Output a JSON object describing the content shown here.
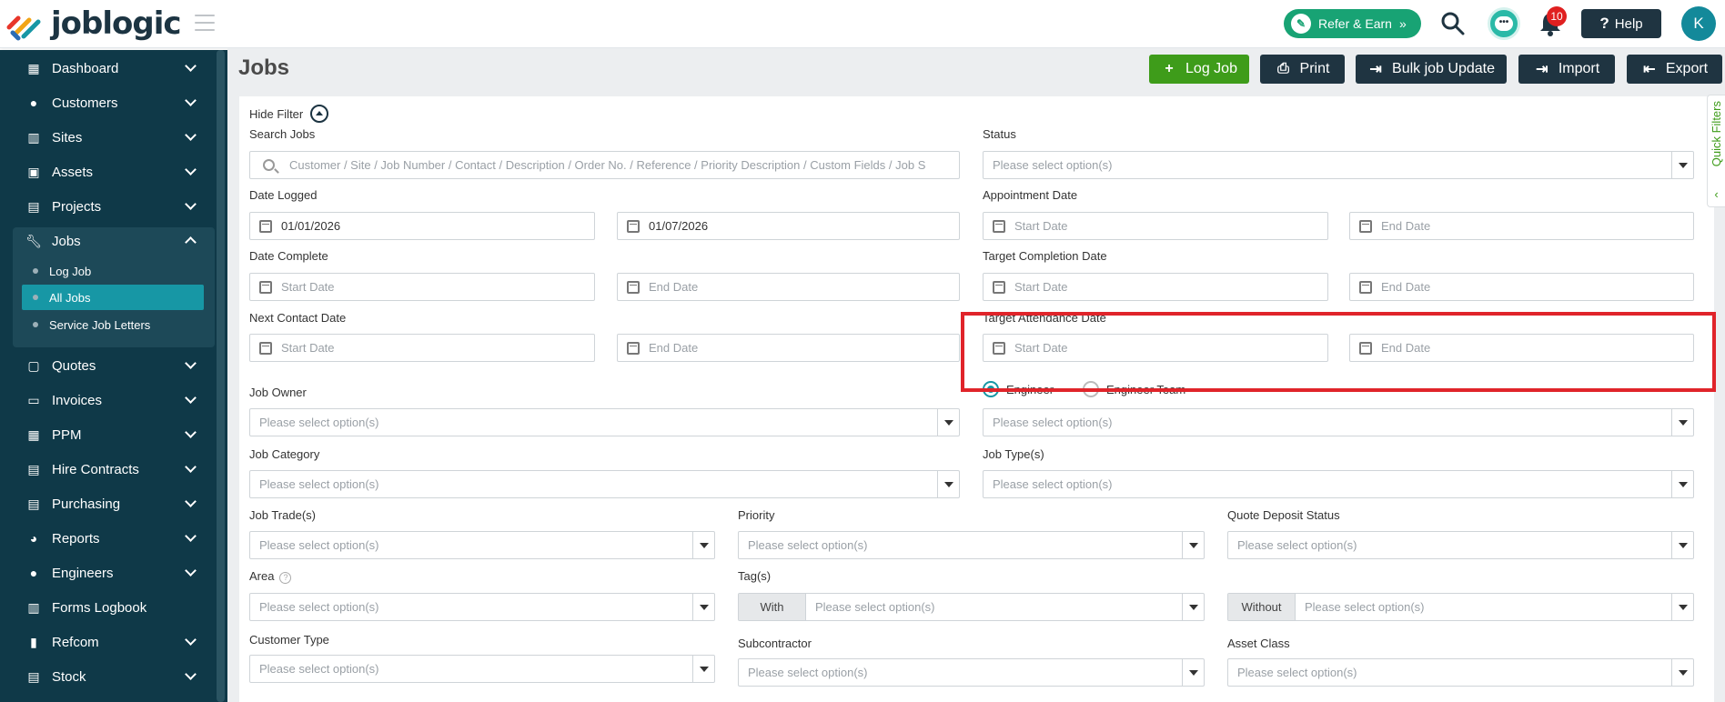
{
  "app": {
    "logo_text": "joblogic",
    "refer_label": "Refer & Earn",
    "notifications_count": "10",
    "help_label": "Help",
    "avatar_initial": "K"
  },
  "sidebar": {
    "items": [
      {
        "label": "Dashboard",
        "icon": "dashboard-icon"
      },
      {
        "label": "Customers",
        "icon": "person-icon"
      },
      {
        "label": "Sites",
        "icon": "building-icon"
      },
      {
        "label": "Assets",
        "icon": "asset-icon"
      },
      {
        "label": "Projects",
        "icon": "projects-icon"
      },
      {
        "label": "Jobs",
        "icon": "wrench-icon"
      },
      {
        "label": "Quotes",
        "icon": "quotes-icon"
      },
      {
        "label": "Invoices",
        "icon": "invoice-icon"
      },
      {
        "label": "PPM",
        "icon": "calendar-icon"
      },
      {
        "label": "Hire Contracts",
        "icon": "document-icon"
      },
      {
        "label": "Purchasing",
        "icon": "purchasing-icon"
      },
      {
        "label": "Reports",
        "icon": "pie-chart-icon"
      },
      {
        "label": "Engineers",
        "icon": "people-icon"
      },
      {
        "label": "Forms Logbook",
        "icon": "book-icon"
      },
      {
        "label": "Refcom",
        "icon": "refcom-icon"
      },
      {
        "label": "Stock",
        "icon": "stock-icon"
      }
    ],
    "jobs_sub": [
      "Log Job",
      "All Jobs",
      "Service Job Letters"
    ]
  },
  "page": {
    "title": "Jobs",
    "actions": [
      "Log Job",
      "Print",
      "Bulk job Update",
      "Import",
      "Export"
    ],
    "hide_filter": "Hide Filter",
    "quick_filters": "Quick Filters"
  },
  "filters": {
    "search_jobs": {
      "label": "Search Jobs",
      "placeholder": "Customer / Site / Job Number / Contact / Description / Order No. / Reference / Priority Description / Custom Fields / Job S"
    },
    "status": {
      "label": "Status",
      "placeholder": "Please select option(s)"
    },
    "date_logged": {
      "label": "Date Logged",
      "start": "01/01/2026",
      "end": "01/07/2026"
    },
    "appointment_date": {
      "label": "Appointment Date",
      "start": "Start Date",
      "end": "End Date"
    },
    "date_complete": {
      "label": "Date Complete",
      "start": "Start Date",
      "end": "End Date"
    },
    "target_completion": {
      "label": "Target Completion Date",
      "start": "Start Date",
      "end": "End Date"
    },
    "next_contact": {
      "label": "Next Contact Date",
      "start": "Start Date",
      "end": "End Date"
    },
    "target_attendance": {
      "label": "Target Attendance Date",
      "start": "Start Date",
      "end": "End Date"
    },
    "job_owner": {
      "label": "Job Owner",
      "placeholder": "Please select option(s)"
    },
    "engineer_radio": "Engineer",
    "engineer_team_radio": "Engineer Team",
    "engineer_select": {
      "placeholder": "Please select option(s)"
    },
    "job_category": {
      "label": "Job Category",
      "placeholder": "Please select option(s)"
    },
    "job_types": {
      "label": "Job Type(s)",
      "placeholder": "Please select option(s)"
    },
    "job_trades": {
      "label": "Job Trade(s)",
      "placeholder": "Please select option(s)"
    },
    "priority": {
      "label": "Priority",
      "placeholder": "Please select option(s)"
    },
    "quote_deposit": {
      "label": "Quote Deposit Status",
      "placeholder": "Please select option(s)"
    },
    "area": {
      "label": "Area",
      "placeholder": "Please select option(s)"
    },
    "tags": {
      "label": "Tag(s)",
      "prefix": "With",
      "placeholder": "Please select option(s)"
    },
    "without": {
      "prefix": "Without",
      "placeholder": "Please select option(s)"
    },
    "customer_type": {
      "label": "Customer Type",
      "placeholder": "Please select option(s)"
    },
    "subcontractor": {
      "label": "Subcontractor",
      "placeholder": "Please select option(s)"
    },
    "asset_class": {
      "label": "Asset Class",
      "placeholder": "Please select option(s)"
    }
  },
  "colors": {
    "sidebar_bg": "#0f3948",
    "accent_teal": "#1797a5",
    "accent_green": "#3e9c1a",
    "dark_button": "#1f3441",
    "highlight_red": "#e0242a"
  }
}
